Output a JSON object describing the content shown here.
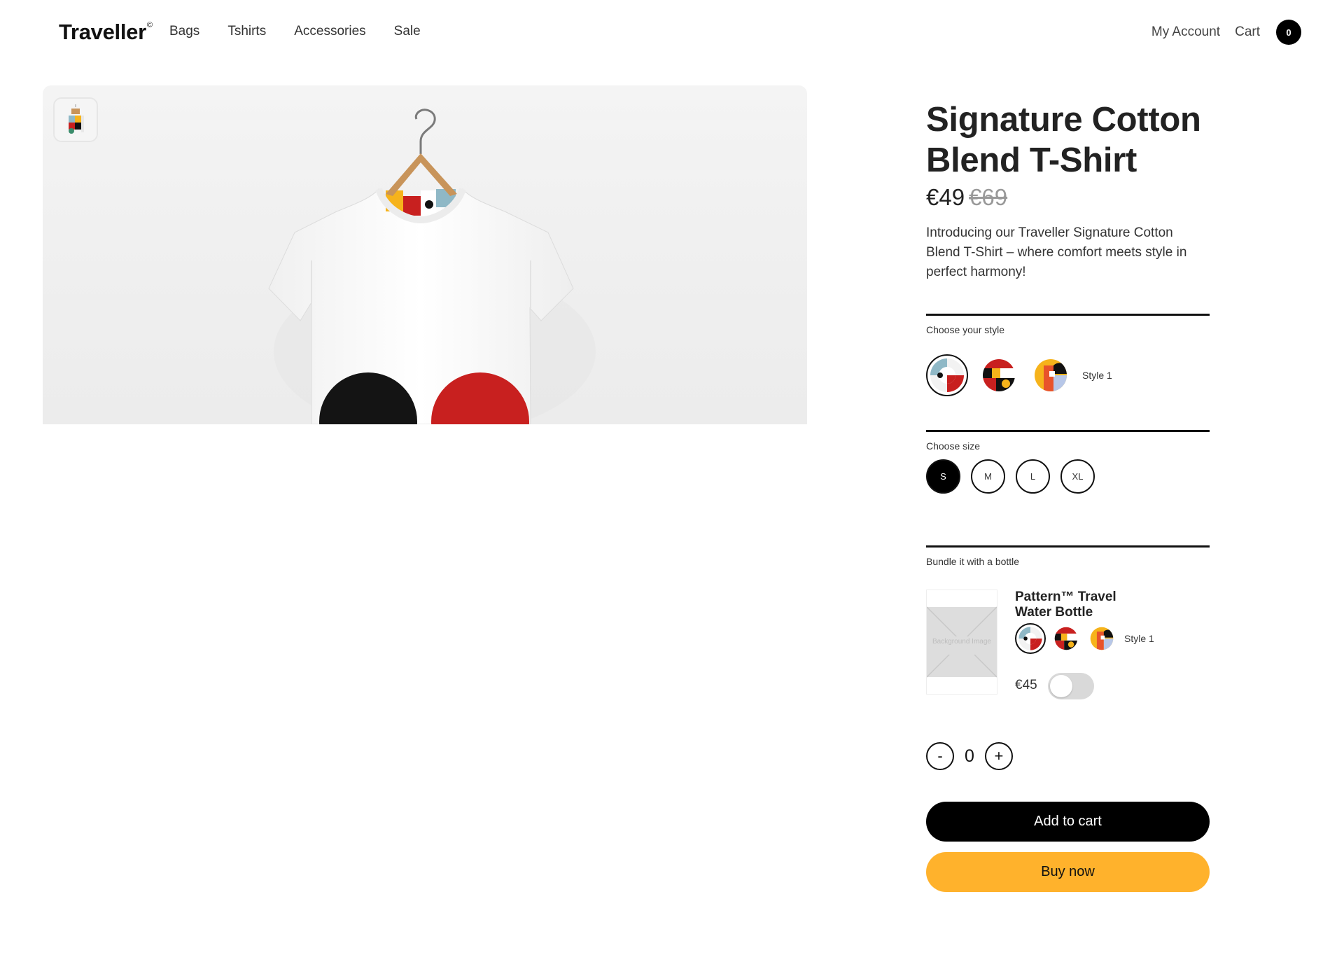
{
  "header": {
    "logo": "Traveller",
    "logo_mark": "©",
    "nav": [
      "Bags",
      "Tshirts",
      "Accessories",
      "Sale"
    ],
    "account_label": "My Account",
    "cart_label": "Cart",
    "cart_count": "0"
  },
  "product": {
    "title": "Signature Cotton Blend T-Shirt",
    "price": "€49",
    "old_price": "€69",
    "description": "Introducing our Traveller Signature Cotton Blend T-Shirt – where comfort meets style in perfect harmony!"
  },
  "style_section": {
    "label": "Choose your style",
    "selected_label": "Style 1",
    "swatch_icons": [
      "style-1-swatch-icon",
      "style-2-swatch-icon",
      "style-3-swatch-icon"
    ]
  },
  "size_section": {
    "label": "Choose size",
    "sizes": [
      "S",
      "M",
      "L",
      "XL"
    ],
    "selected": "S"
  },
  "bundle": {
    "label": "Bundle it with a bottle",
    "title": "Pattern™ Travel Water Bottle",
    "image_placeholder": "Background Image",
    "selected_label": "Style 1",
    "price": "€45",
    "toggle_on": false
  },
  "quantity": {
    "minus": "-",
    "value": "0",
    "plus": "+"
  },
  "buttons": {
    "add_to_cart": "Add to cart",
    "buy_now": "Buy now"
  },
  "colors": {
    "primary": "#000000",
    "buy_now": "#ffb22c",
    "text": "#222222",
    "old_price": "#999999",
    "pattern_red": "#c8201f",
    "pattern_black": "#111111",
    "pattern_blue": "#8fb8c6",
    "pattern_yellow": "#f6b31b"
  }
}
